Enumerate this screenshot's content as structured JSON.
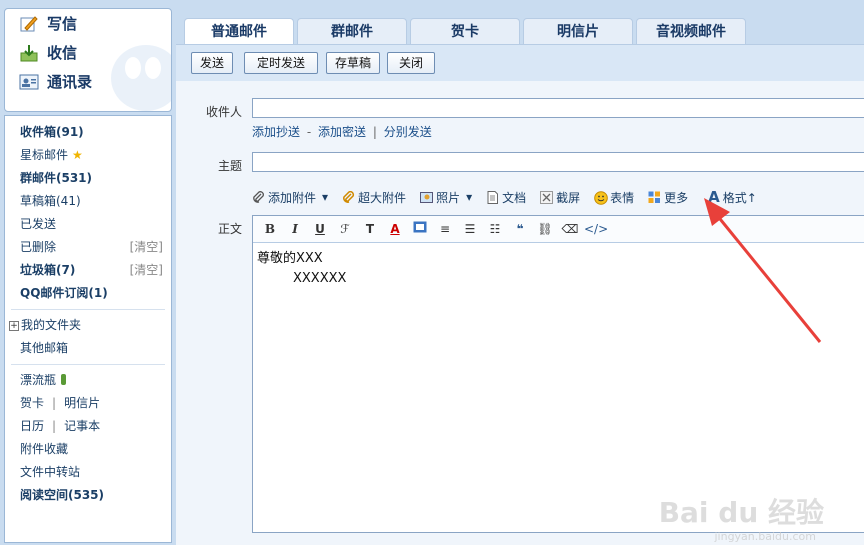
{
  "sidebar": {
    "top": {
      "compose": "写信",
      "inbox": "收信",
      "contacts": "通讯录"
    },
    "folders": [
      {
        "label": "收件箱(91)",
        "bold": true
      },
      {
        "label": "星标邮件",
        "bold": false
      },
      {
        "label": "群邮件(531)",
        "bold": true
      },
      {
        "label": "草稿箱(41)",
        "bold": false
      },
      {
        "label": "已发送",
        "bold": false
      },
      {
        "label": "已删除",
        "bold": false
      },
      {
        "label": "垃圾箱(7)",
        "bold": true
      },
      {
        "label": "QQ邮件订阅(1)",
        "bold": true
      }
    ],
    "clear_label": "[清空]",
    "my_folders": "我的文件夹",
    "other_mailbox": "其他邮箱",
    "apps": {
      "drift_bottle": "漂流瓶",
      "greeting_card": "贺卡",
      "postcard": "明信片",
      "calendar": "日历",
      "notepad": "记事本",
      "attach_fav": "附件收藏",
      "file_transfer": "文件中转站",
      "reading_space": "阅读空间(535)"
    }
  },
  "tabs": [
    "普通邮件",
    "群邮件",
    "贺卡",
    "明信片",
    "音视频邮件"
  ],
  "toolbar": {
    "send": "发送",
    "scheduled": "定时发送",
    "save_draft": "存草稿",
    "close": "关闭"
  },
  "form": {
    "to_label": "收件人",
    "to_value": "",
    "add_cc": "添加抄送",
    "add_bcc": "添加密送",
    "sep_dash": "-",
    "sep_bar": "|",
    "send_separately": "分别发送",
    "subject_label": "主题",
    "subject_value": "",
    "body_label": "正文"
  },
  "attach_bar": {
    "add_attachment": "添加附件",
    "big_attachment": "超大附件",
    "photo": "照片",
    "document": "文档",
    "screenshot": "截屏",
    "emoji": "表情",
    "more": "更多",
    "format": "格式↑"
  },
  "editor": {
    "line1": "尊敬的XXX",
    "line2": "XXXXXX"
  },
  "watermark": {
    "main": "Bai du 经验",
    "sub": "jingyan.baidu.com"
  },
  "colors": {
    "accent": "#1b4f8a",
    "arrow": "#e8403a"
  }
}
